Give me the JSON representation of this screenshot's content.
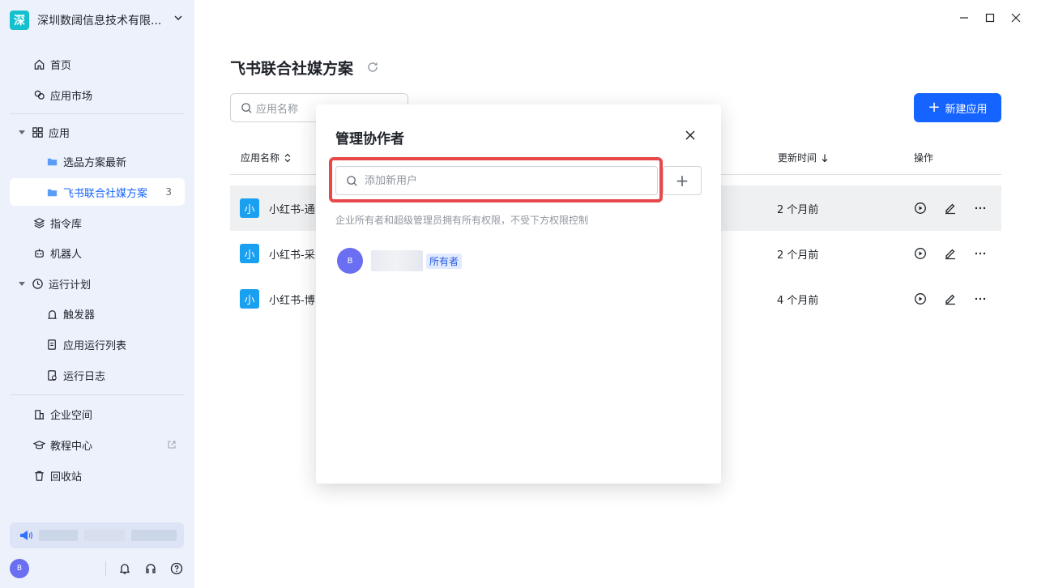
{
  "sidebar": {
    "org": {
      "logo": "深",
      "name": "深圳数阔信息技术有限..."
    },
    "items": [
      {
        "label": "首页",
        "icon": "home-icon"
      },
      {
        "label": "应用市场",
        "icon": "market-icon"
      },
      {
        "label": "应用",
        "icon": "grid-icon"
      },
      {
        "label": "选品方案最新",
        "icon": "folder-icon"
      },
      {
        "label": "飞书联合社媒方案",
        "icon": "folder-icon",
        "count": "3"
      },
      {
        "label": "指令库",
        "icon": "layers-icon"
      },
      {
        "label": "机器人",
        "icon": "robot-icon"
      },
      {
        "label": "运行计划",
        "icon": "clock-icon"
      },
      {
        "label": "触发器",
        "icon": "trigger-icon"
      },
      {
        "label": "应用运行列表",
        "icon": "list-icon"
      },
      {
        "label": "运行日志",
        "icon": "log-icon"
      },
      {
        "label": "企业空间",
        "icon": "building-icon"
      },
      {
        "label": "教程中心",
        "icon": "graduation-icon"
      },
      {
        "label": "回收站",
        "icon": "trash-icon"
      }
    ],
    "user_initial": "B"
  },
  "main": {
    "title": "飞书联合社媒方案",
    "search_placeholder": "应用名称",
    "new_button": "新建应用",
    "columns": {
      "name": "应用名称",
      "updated": "更新时间",
      "actions": "操作"
    },
    "rows": [
      {
        "badge": "小",
        "name": "小红书-通",
        "time": "2 个月前"
      },
      {
        "badge": "小",
        "name": "小红书-采",
        "time": "2 个月前"
      },
      {
        "badge": "小",
        "name": "小红书-博",
        "time": "4 个月前"
      }
    ]
  },
  "modal": {
    "title": "管理协作者",
    "input_placeholder": "添加新用户",
    "add_label": "+",
    "hint": "企业所有者和超级管理员拥有所有权限，不受下方权限控制",
    "member": {
      "initial": "B",
      "role": "所有者"
    }
  },
  "colors": {
    "accent": "#1664ff",
    "highlight": "#e9484a",
    "sidebar_bg": "#edf1fb"
  }
}
